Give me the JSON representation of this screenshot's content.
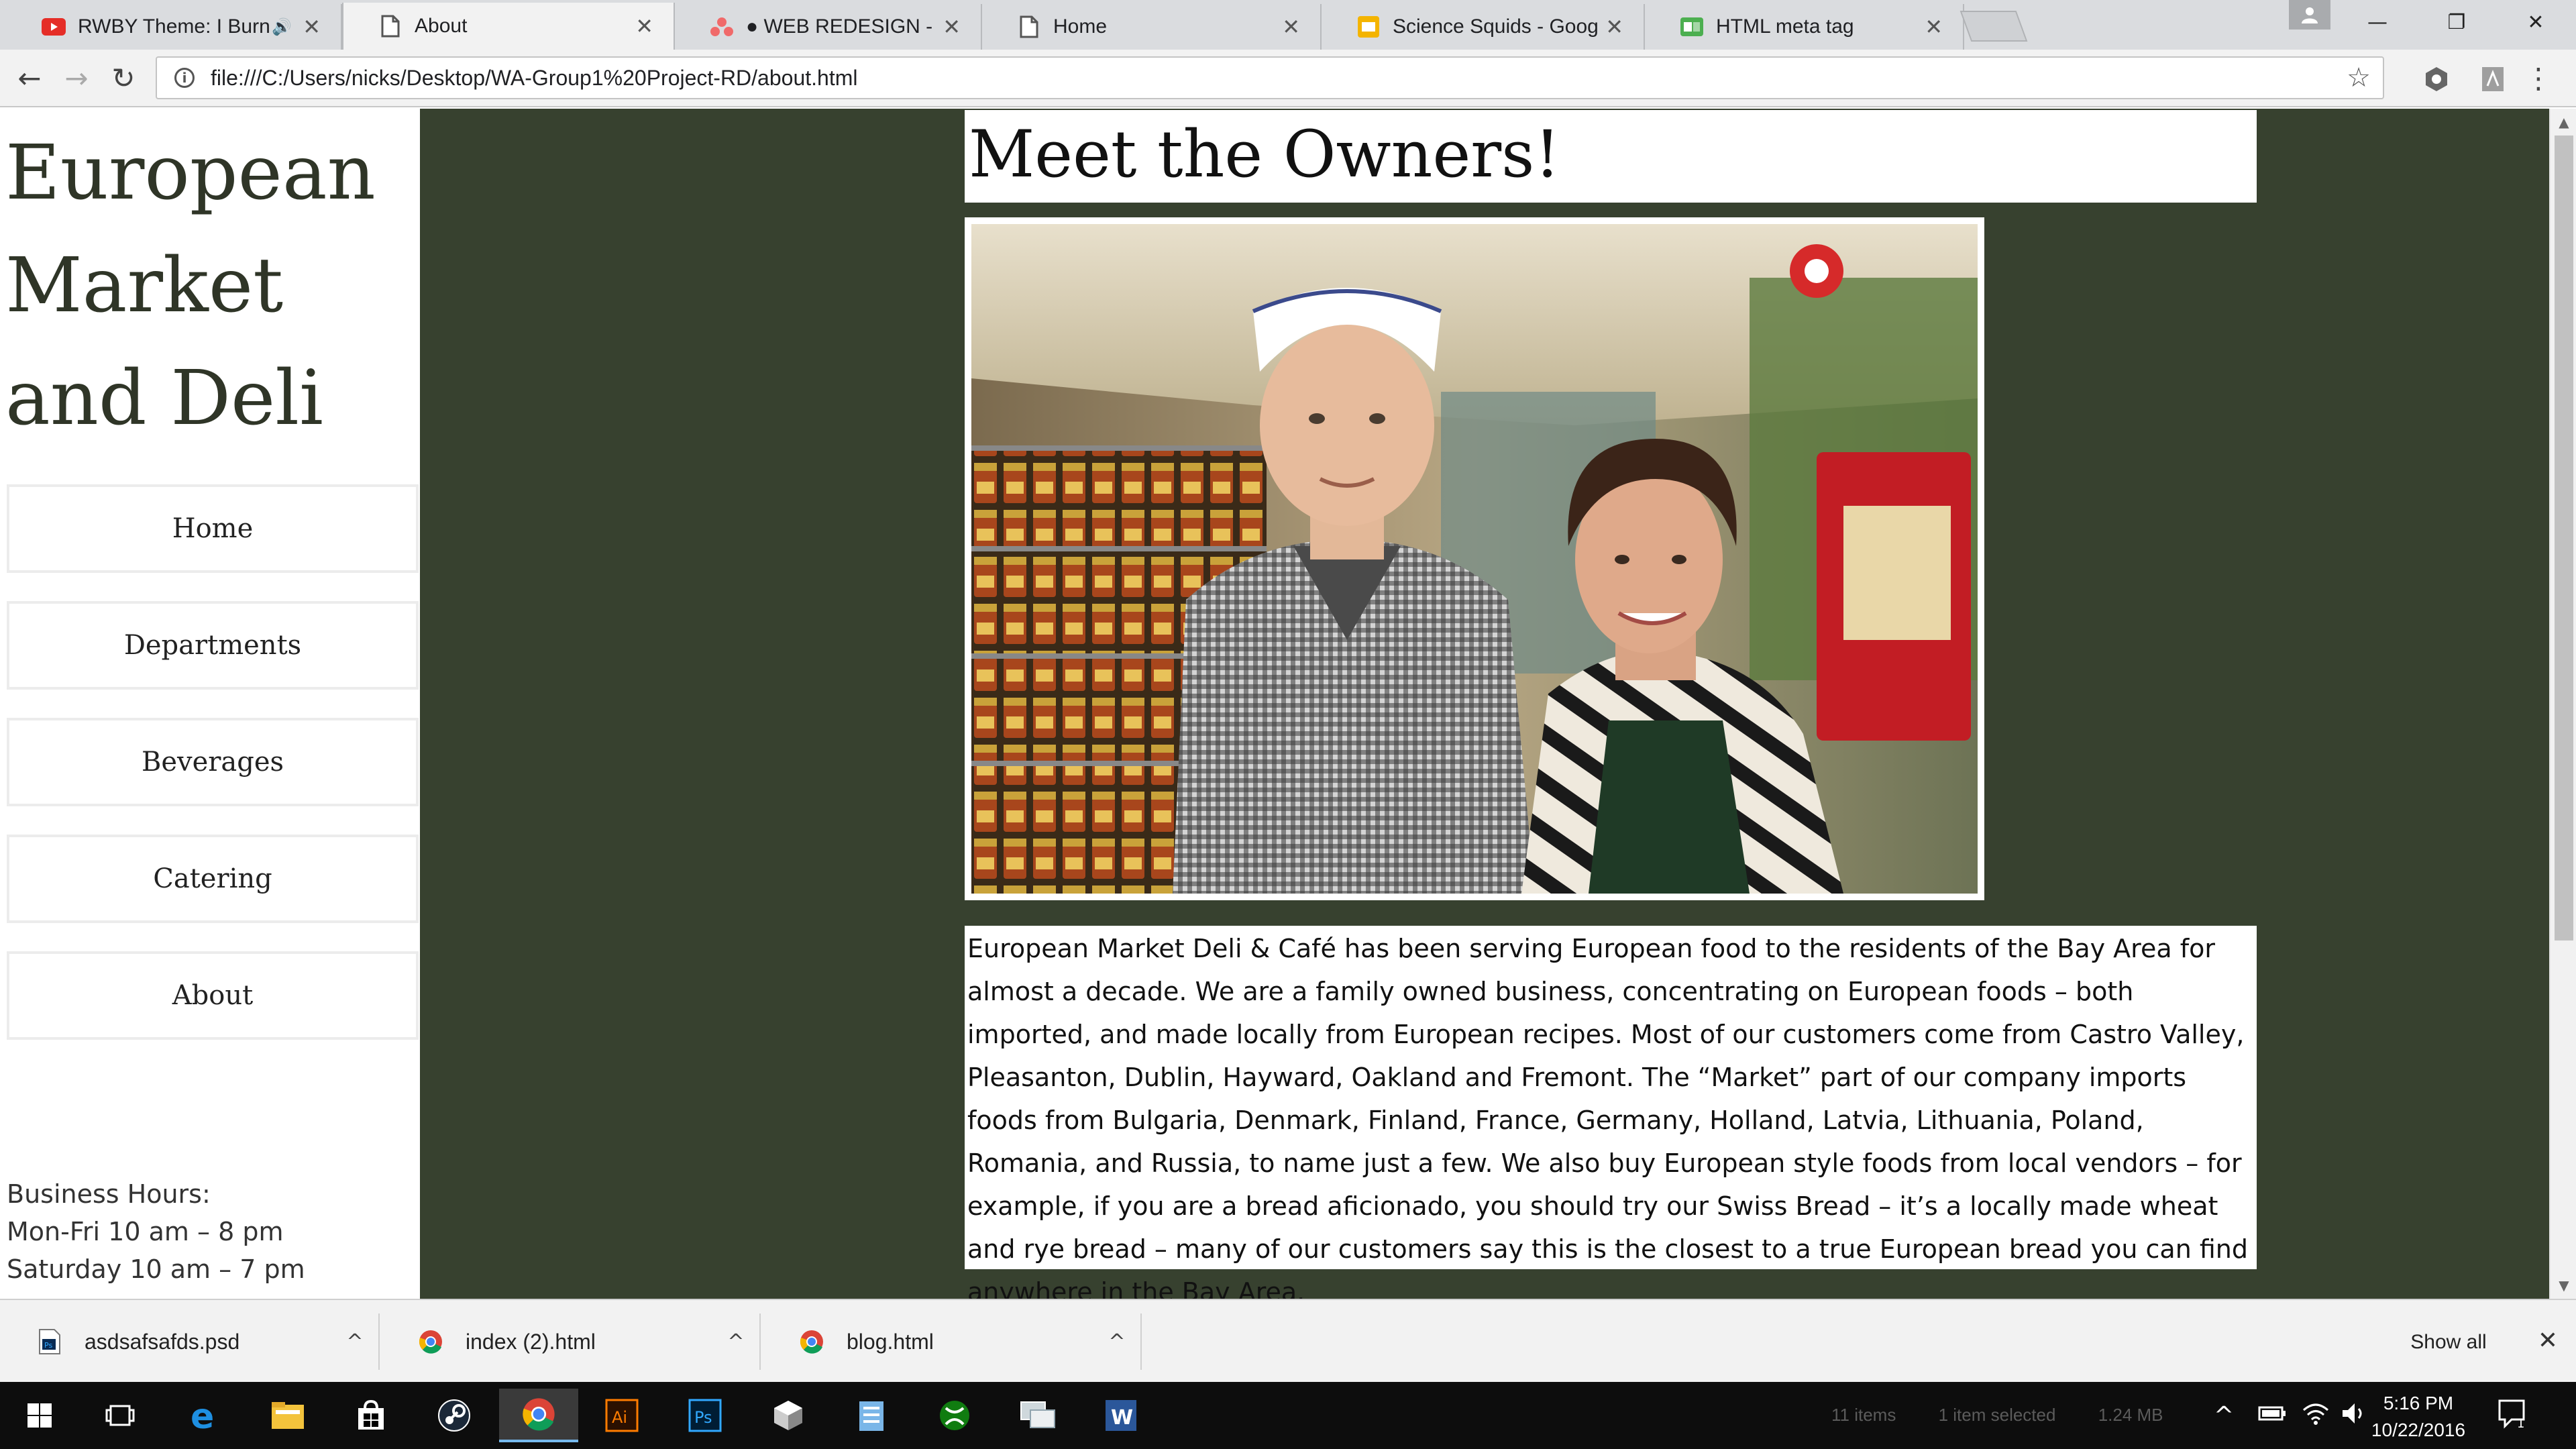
{
  "browser": {
    "tabs": [
      {
        "title": "RWBY Theme: I Burn (",
        "favicon": "youtube-icon",
        "audio": true,
        "active": false
      },
      {
        "title": "About",
        "favicon": "page-icon",
        "active": true
      },
      {
        "title": "● WEB REDESIGN - Asan",
        "favicon": "asana-icon",
        "active": false
      },
      {
        "title": "Home",
        "favicon": "page-icon",
        "active": false
      },
      {
        "title": "Science Squids - Google",
        "favicon": "slides-icon",
        "active": false
      },
      {
        "title": "HTML meta tag",
        "favicon": "w3-icon",
        "active": false
      }
    ],
    "close_glyph": "✕",
    "url": "file:///C:/Users/nicks/Desktop/WA-Group1%20Project-RD/about.html",
    "icons": {
      "back": "←",
      "forward": "→",
      "reload": "↻",
      "star": "☆",
      "menu": "⋮",
      "minimize": "—",
      "restore": "❐",
      "close": "✕"
    }
  },
  "site": {
    "title": "European Market and Deli",
    "nav": [
      "Home",
      "Departments",
      "Beverages",
      "Catering",
      "About"
    ],
    "hours": {
      "label": "Business Hours:",
      "weekday": "Mon-Fri 10 am – 8 pm",
      "saturday": "Saturday 10 am – 7 pm"
    },
    "heading": "Meet the Owners!",
    "about": "European Market Deli & Café has been serving European food to the residents of the Bay Area for almost a decade. We are a family owned business, concentrating on European foods – both imported, and made locally from European recipes. Most of our customers come from Castro Valley, Pleasanton, Dublin, Hayward, Oakland and Fremont. The “Market” part of our company imports foods from Bulgaria, Denmark, Finland, France, Germany, Holland, Latvia, Lithuania, Poland, Romania, and Russia, to name just a few. We also buy European style foods from local vendors – for example, if you are a bread aficionado, you should try our Swiss Bread – it’s a locally made wheat and rye bread – many of our customers say this is the closest to a true European bread you can find anywhere in the Bay Area.",
    "colors": {
      "main_bg": "#37412f",
      "title": "#2f3527"
    }
  },
  "downloads": {
    "items": [
      {
        "name": "asdsafsafds.psd",
        "icon": "photoshop-file-icon"
      },
      {
        "name": "index (2).html",
        "icon": "chrome-file-icon"
      },
      {
        "name": "blog.html",
        "icon": "chrome-file-icon"
      }
    ],
    "caret": "^",
    "show_all": "Show all",
    "close": "✕"
  },
  "taskbar": {
    "items": [
      "windows-start-icon",
      "task-view-icon",
      "edge-icon",
      "file-explorer-icon",
      "store-icon",
      "steam-icon",
      "chrome-icon",
      "illustrator-icon",
      "photoshop-icon",
      "unity-icon",
      "notepad-icon",
      "xbox-icon",
      "remote-icon",
      "word-icon"
    ],
    "illustrator_label": "Ai",
    "photoshop_label": "Ps",
    "word_label": "W",
    "status": {
      "items": "11 items",
      "selected": "1 item selected",
      "size": "1.24 MB"
    },
    "time": "5:16 PM",
    "date": "10/22/2016",
    "notifications": "1"
  }
}
